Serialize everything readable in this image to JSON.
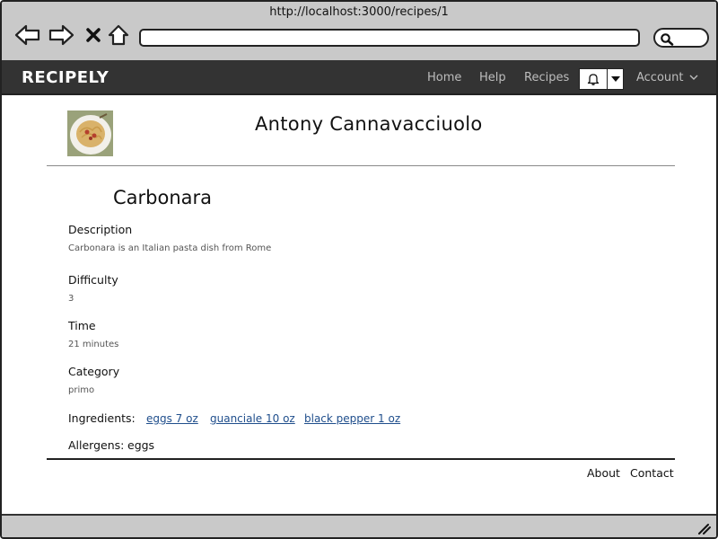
{
  "browser": {
    "url": "http://localhost:3000/recipes/1"
  },
  "header": {
    "brand": "RECIPELY",
    "nav": [
      "Home",
      "Help",
      "Recipes"
    ],
    "account": "Account"
  },
  "chef": {
    "name": "Antony Cannavacciuolo"
  },
  "recipe": {
    "title": "Carbonara",
    "description_label": "Description",
    "description": "Carbonara is an Italian pasta dish from Rome",
    "difficulty_label": "Difficulty",
    "difficulty": "3",
    "time_label": "Time",
    "time": "21 minutes",
    "category_label": "Category",
    "category": "primo",
    "ingredients_label": "Ingredients:",
    "ingredients": [
      "eggs 7 oz",
      "guanciale 10 oz",
      "black pepper 1 oz"
    ],
    "allergens_label": "Allergens:",
    "allergens": "eggs"
  },
  "footer": {
    "about": "About",
    "contact": "Contact"
  },
  "icons": {
    "back": "back-arrow-icon",
    "forward": "forward-arrow-icon",
    "stop": "close-icon",
    "home": "home-icon",
    "search": "search-icon",
    "notifications": "bell-icon",
    "dropdown": "caret-down-icon",
    "resize": "resize-grip-icon"
  },
  "colors": {
    "chrome": "#c9c9c9",
    "header_bg": "#333333",
    "link": "#1f4e8c",
    "nav_text": "#bdbdbd"
  }
}
